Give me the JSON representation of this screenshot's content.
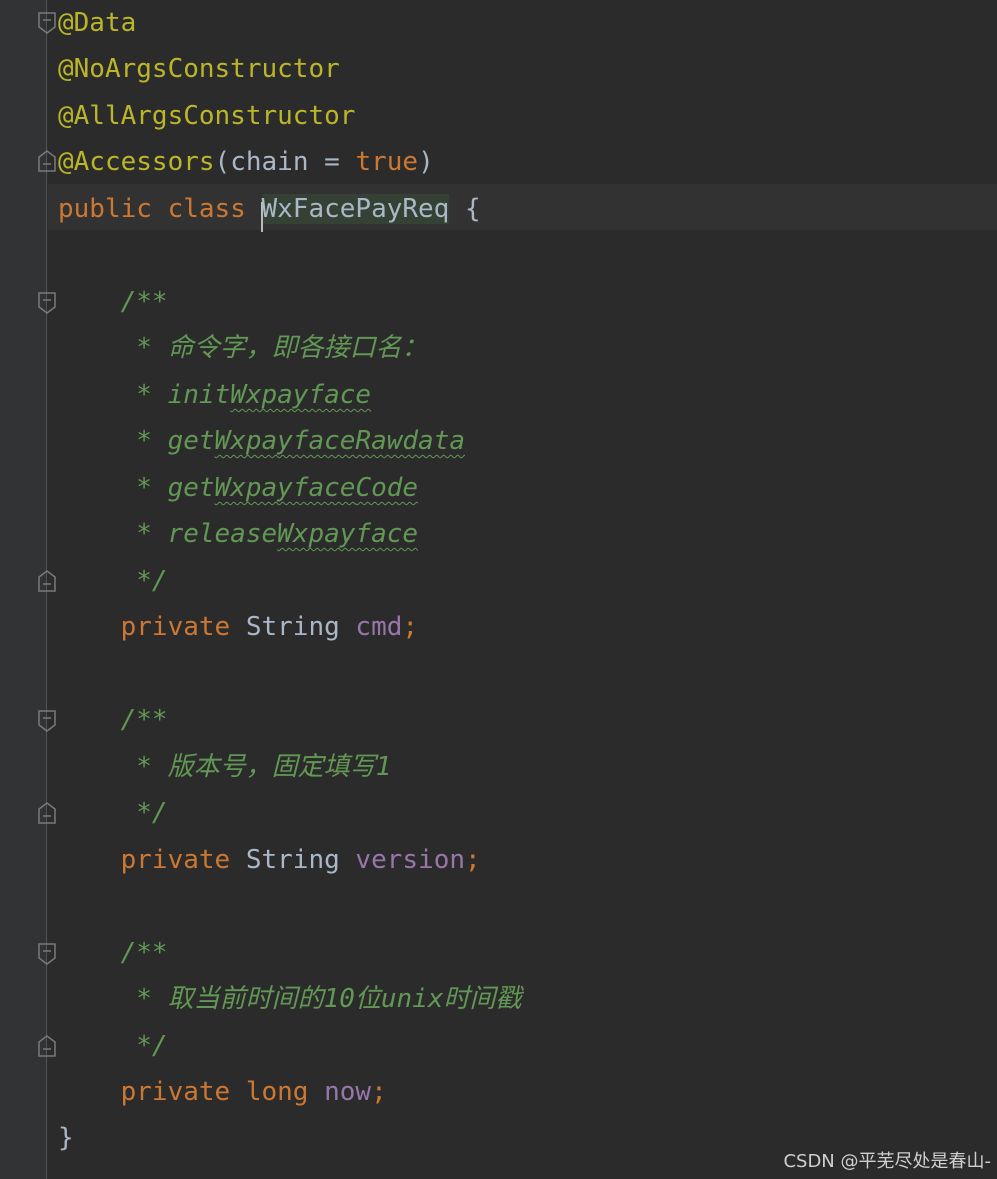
{
  "editor": {
    "lines": {
      "l1": {
        "anno": "@Data"
      },
      "l2": {
        "anno": "@NoArgsConstructor"
      },
      "l3": {
        "anno": "@AllArgsConstructor"
      },
      "l4": {
        "anno": "@Accessors",
        "open": "(",
        "param": "chain",
        "eq": " = ",
        "value": "true",
        "close": ")"
      },
      "l5": {
        "kw": "public class ",
        "name": "WxFacePayReq",
        "rest": " {"
      },
      "l7": {
        "text": "    /**"
      },
      "l8": {
        "text": "     * 命令字，即各接口名："
      },
      "l9": {
        "pre": "     * init",
        "squiggle": "Wxpayface"
      },
      "l10": {
        "pre": "     * get",
        "squiggle": "WxpayfaceRawdata"
      },
      "l11": {
        "pre": "     * get",
        "squiggle": "Wxpayface",
        "post": "Code"
      },
      "l12": {
        "pre": "     * release",
        "squiggle": "Wxpayface"
      },
      "l13": {
        "text": "     */"
      },
      "l14": {
        "kw": "    private ",
        "type": "String ",
        "field": "cmd",
        "semi": ";"
      },
      "l16": {
        "text": "    /**"
      },
      "l17": {
        "text": "     * 版本号，固定填写1"
      },
      "l18": {
        "text": "     */"
      },
      "l19": {
        "kw": "    private ",
        "type": "String ",
        "field": "version",
        "semi": ";"
      },
      "l21": {
        "text": "    /**"
      },
      "l22": {
        "text": "     * 取当前时间的10位unix时间戳"
      },
      "l23": {
        "text": "     */"
      },
      "l24": {
        "kw": "    private long ",
        "field": "now",
        "semi": ";"
      },
      "l25": {
        "text": "}"
      }
    }
  },
  "watermark": "CSDN @平芜尽处是春山-",
  "colors": {
    "background": "#2b2b2b",
    "annotation": "#bbb529",
    "keyword": "#cc7832",
    "field": "#9876aa",
    "plain": "#a9b7c6",
    "doc_comment": "#629755"
  }
}
